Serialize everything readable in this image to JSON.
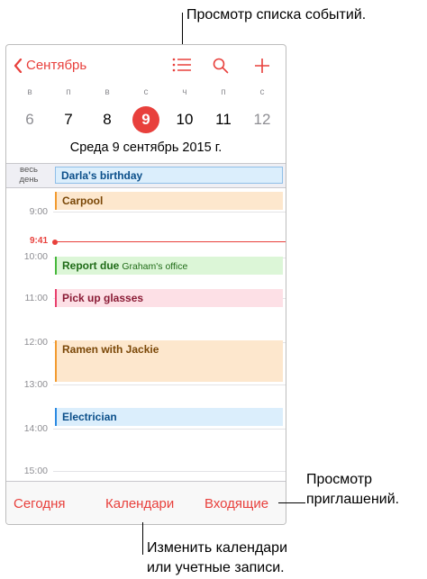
{
  "nav": {
    "back_label": "Сентябрь"
  },
  "week": {
    "days": [
      "в",
      "п",
      "в",
      "с",
      "ч",
      "п",
      "с"
    ],
    "dates": [
      "6",
      "7",
      "8",
      "9",
      "10",
      "11",
      "12"
    ],
    "selected_index": 3
  },
  "date_title": "Среда 9 сентябрь 2015 г.",
  "all_day": {
    "label": "весь\nдень",
    "event_title": "Darla's birthday"
  },
  "hours": [
    "9:00",
    "10:00",
    "11:00",
    "12:00",
    "13:00",
    "14:00",
    "15:00"
  ],
  "now_time": "9:41",
  "events": [
    {
      "title": "Carpool",
      "location": "",
      "color": "orange"
    },
    {
      "title": "Report due",
      "location": "Graham's office",
      "color": "green"
    },
    {
      "title": "Pick up glasses",
      "location": "",
      "color": "pink"
    },
    {
      "title": "Ramen with Jackie",
      "location": "",
      "color": "orange"
    },
    {
      "title": "Electrician",
      "location": "",
      "color": "blue"
    }
  ],
  "toolbar": {
    "today": "Сегодня",
    "calendars": "Календари",
    "inbox": "Входящие"
  },
  "callouts": {
    "list_view": "Просмотр списка событий.",
    "invitations": "Просмотр\nприглашений.",
    "edit_calendars": "Изменить календари\nили учетные записи."
  },
  "colors": {
    "accent": "#e8403c"
  }
}
